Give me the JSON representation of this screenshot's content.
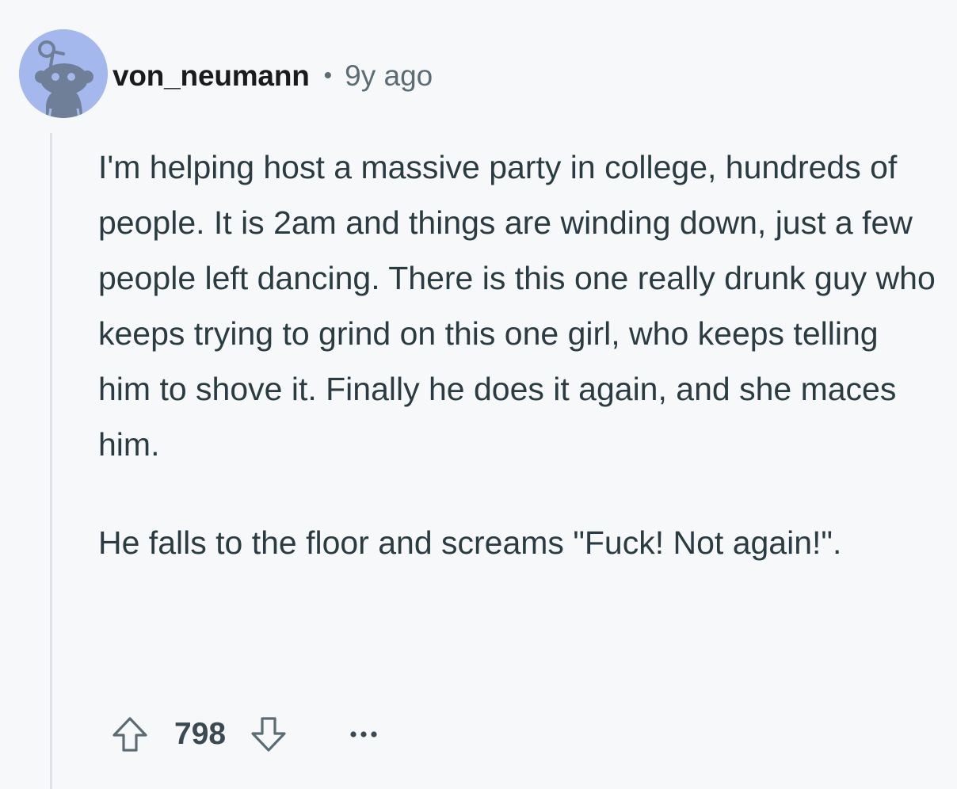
{
  "comment": {
    "username": "von_neumann",
    "separator": "•",
    "age": "9y ago",
    "paragraphs": [
      "I'm helping host a massive party in college, hundreds of people. It is 2am and things are winding down, just a few people left dancing. There is this one really drunk guy who keeps trying to grind on this one girl, who keeps telling him to shove it. Finally he does it again, and she maces him.",
      "He falls to the floor and screams \"Fuck! Not again!\"."
    ],
    "score": "798",
    "icons": {
      "avatar": "snoo-avatar-icon",
      "upvote": "upvote-arrow-icon",
      "downvote": "downvote-arrow-icon",
      "more": "more-options-icon"
    },
    "colors": {
      "avatar_bg": "#a4b8ee",
      "text": "#2a3c42",
      "muted": "#5c6c74",
      "background": "#f7f8fa"
    }
  }
}
